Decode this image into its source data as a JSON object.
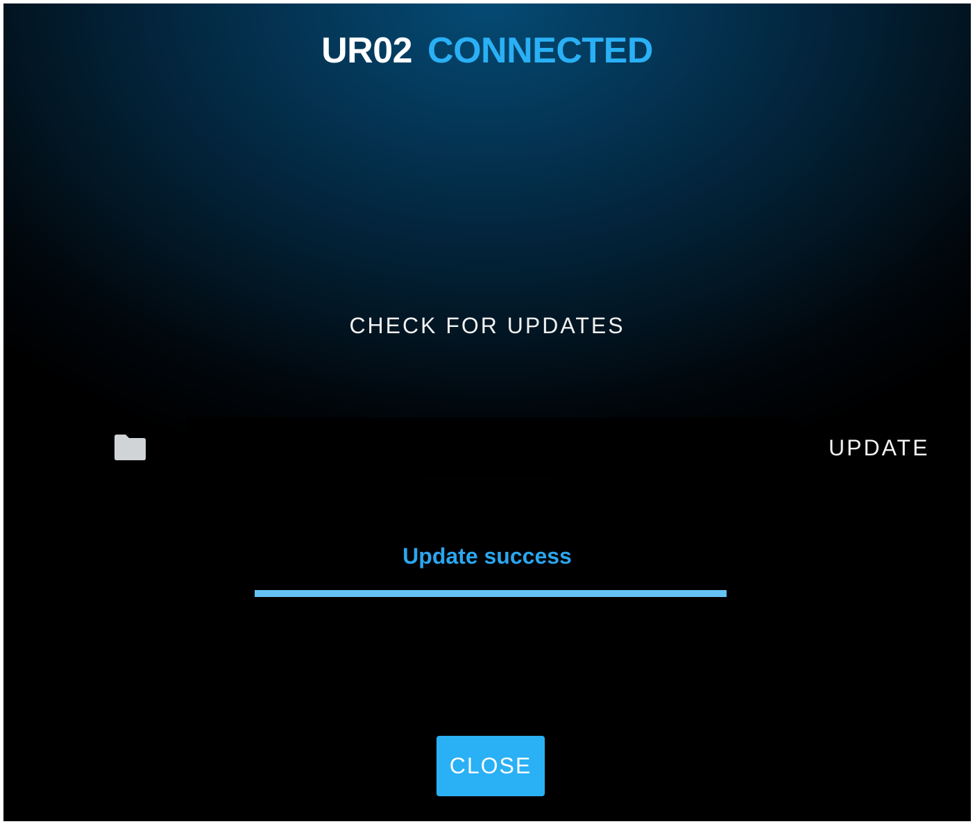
{
  "header": {
    "device_name": "UR02",
    "connection_status": "CONNECTED"
  },
  "actions": {
    "check_updates_label": "CHECK FOR UPDATES",
    "update_label": "UPDATE",
    "close_label": "CLOSE"
  },
  "file_picker": {
    "icon": "folder-icon",
    "value": ""
  },
  "progress": {
    "message": "Update success",
    "percent": 100
  },
  "colors": {
    "accent": "#2ab0f5",
    "progress_fill": "#66c3f5",
    "background_top": "#054a73",
    "background_bottom": "#000000"
  }
}
